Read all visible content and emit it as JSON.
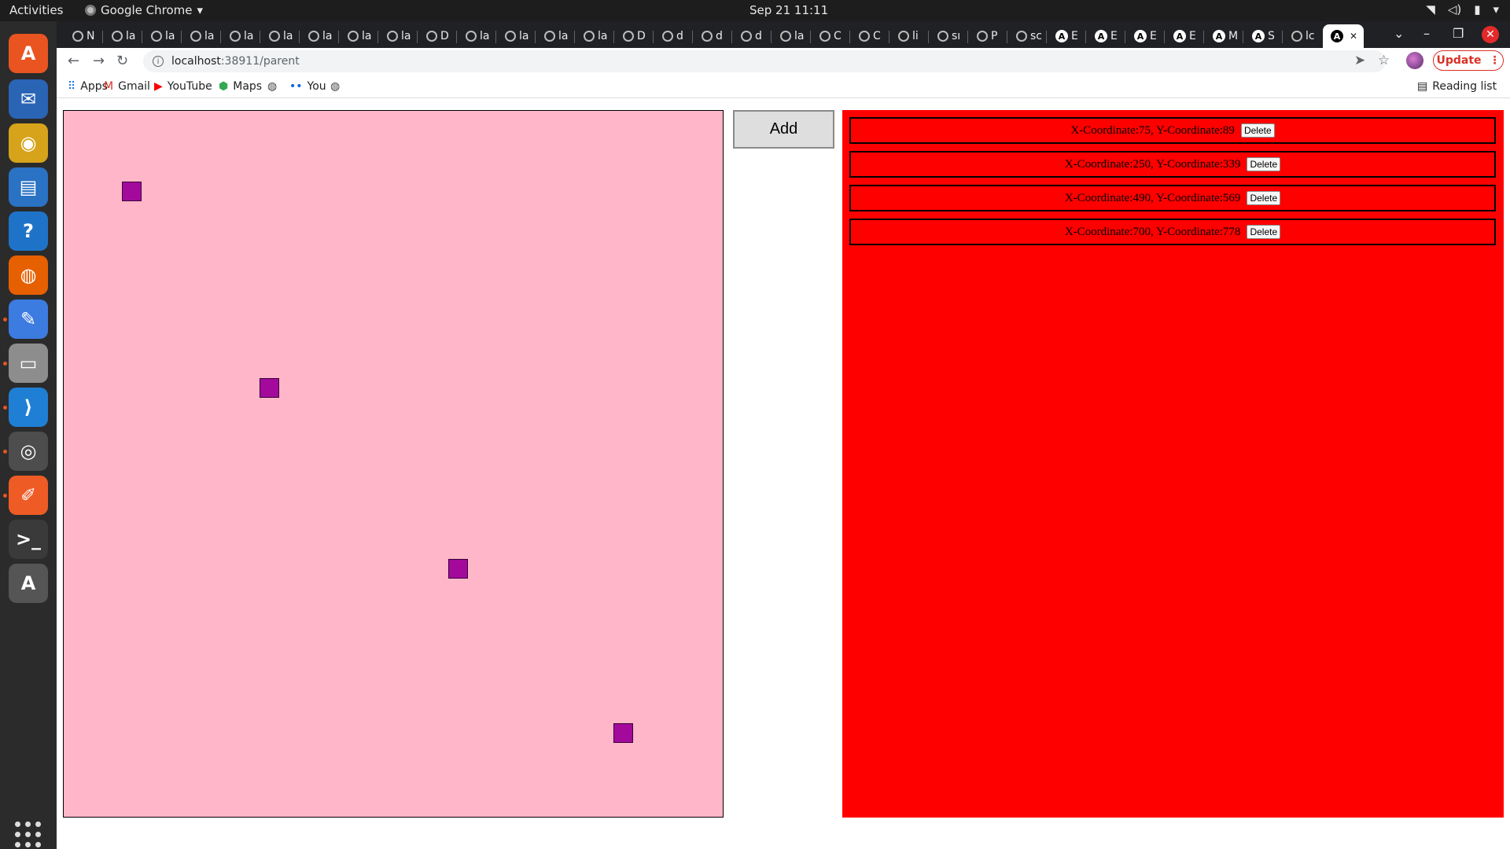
{
  "system": {
    "activities_label": "Activities",
    "app_name": "Google Chrome",
    "app_menu_icon": "caret-down-icon",
    "clock": "Sep 21  11:11",
    "tray_icons": [
      "wifi-icon",
      "volume-icon",
      "battery-icon",
      "caret-down-icon"
    ]
  },
  "dock": {
    "apps": [
      {
        "name": "ubuntu-software",
        "glyph": "A",
        "color": "#e95420"
      },
      {
        "name": "thunderbird",
        "glyph": "✉",
        "color": "#2a64b5"
      },
      {
        "name": "rhythmbox",
        "glyph": "◉",
        "color": "#d6a31a"
      },
      {
        "name": "libreoffice-writer",
        "glyph": "▤",
        "color": "#2a72c4"
      },
      {
        "name": "help",
        "glyph": "?",
        "color": "#1e73c8"
      },
      {
        "name": "firefox",
        "glyph": "◍",
        "color": "#e66000"
      },
      {
        "name": "text-editor",
        "glyph": "✎",
        "color": "#3c7be0"
      },
      {
        "name": "files",
        "glyph": "▭",
        "color": "#8d8d8d"
      },
      {
        "name": "vscode",
        "glyph": "⟩",
        "color": "#1f7fd4"
      },
      {
        "name": "chrome",
        "glyph": "◎",
        "color": "#4d4d4d"
      },
      {
        "name": "postman",
        "glyph": "✐",
        "color": "#ef5b25"
      },
      {
        "name": "terminal",
        "glyph": ">_",
        "color": "#3a3a3a"
      },
      {
        "name": "software-updater",
        "glyph": "A",
        "color": "#555555"
      }
    ]
  },
  "browser": {
    "tabs": [
      {
        "label": "N",
        "icon": "globe"
      },
      {
        "label": "la",
        "icon": "globe"
      },
      {
        "label": "la",
        "icon": "globe"
      },
      {
        "label": "la",
        "icon": "globe"
      },
      {
        "label": "la",
        "icon": "globe"
      },
      {
        "label": "la",
        "icon": "globe"
      },
      {
        "label": "la",
        "icon": "globe"
      },
      {
        "label": "la",
        "icon": "globe"
      },
      {
        "label": "la",
        "icon": "globe"
      },
      {
        "label": "D",
        "icon": "globe"
      },
      {
        "label": "la",
        "icon": "globe"
      },
      {
        "label": "la",
        "icon": "globe"
      },
      {
        "label": "la",
        "icon": "globe"
      },
      {
        "label": "la",
        "icon": "globe"
      },
      {
        "label": "D",
        "icon": "globe"
      },
      {
        "label": "d",
        "icon": "globe"
      },
      {
        "label": "d",
        "icon": "globe"
      },
      {
        "label": "d",
        "icon": "globe"
      },
      {
        "label": "la",
        "icon": "globe"
      },
      {
        "label": "C",
        "icon": "globe"
      },
      {
        "label": "C",
        "icon": "globe"
      },
      {
        "label": "li",
        "icon": "globe"
      },
      {
        "label": "sı",
        "icon": "globe"
      },
      {
        "label": "P",
        "icon": "globe"
      },
      {
        "label": "sc",
        "icon": "globe"
      },
      {
        "label": "E",
        "icon": "angular"
      },
      {
        "label": "E",
        "icon": "angular"
      },
      {
        "label": "E",
        "icon": "angular"
      },
      {
        "label": "E",
        "icon": "angular"
      },
      {
        "label": "M",
        "icon": "angular"
      },
      {
        "label": "S",
        "icon": "angular"
      },
      {
        "label": "lc",
        "icon": "globe"
      },
      {
        "label": "",
        "icon": "angular",
        "active": true
      }
    ],
    "new_tab_label": "+",
    "tab_search_icon": "chevron-down-icon",
    "url_host": "localhost",
    "url_rest": ":38911/parent",
    "update_label": "Update",
    "bookmarks": [
      {
        "label": "Apps",
        "icon": "apps-grid-icon"
      },
      {
        "label": "Gmail",
        "icon": "gmail-icon"
      },
      {
        "label": "YouTube",
        "icon": "youtube-icon"
      },
      {
        "label": "Maps",
        "icon": "maps-icon"
      },
      {
        "label": "",
        "icon": "globe-icon"
      },
      {
        "label": "You",
        "icon": "flickr-icon"
      },
      {
        "label": "",
        "icon": "globe-icon"
      }
    ],
    "reading_list_label": "Reading list"
  },
  "page": {
    "add_label": "Add",
    "canvas_background": "#ffb6c9",
    "square_color": "#a30a9b",
    "list_background": "#ff0000",
    "items": [
      {
        "text": "X-Coordinate:75, Y-Coordinate:89",
        "delete_label": "Delete"
      },
      {
        "text": "X-Coordinate:250, Y-Coordinate:339",
        "delete_label": "Delete"
      },
      {
        "text": "X-Coordinate:490, Y-Coordinate:569",
        "delete_label": "Delete"
      },
      {
        "text": "X-Coordinate:700, Y-Coordinate:778",
        "delete_label": "Delete"
      }
    ]
  }
}
